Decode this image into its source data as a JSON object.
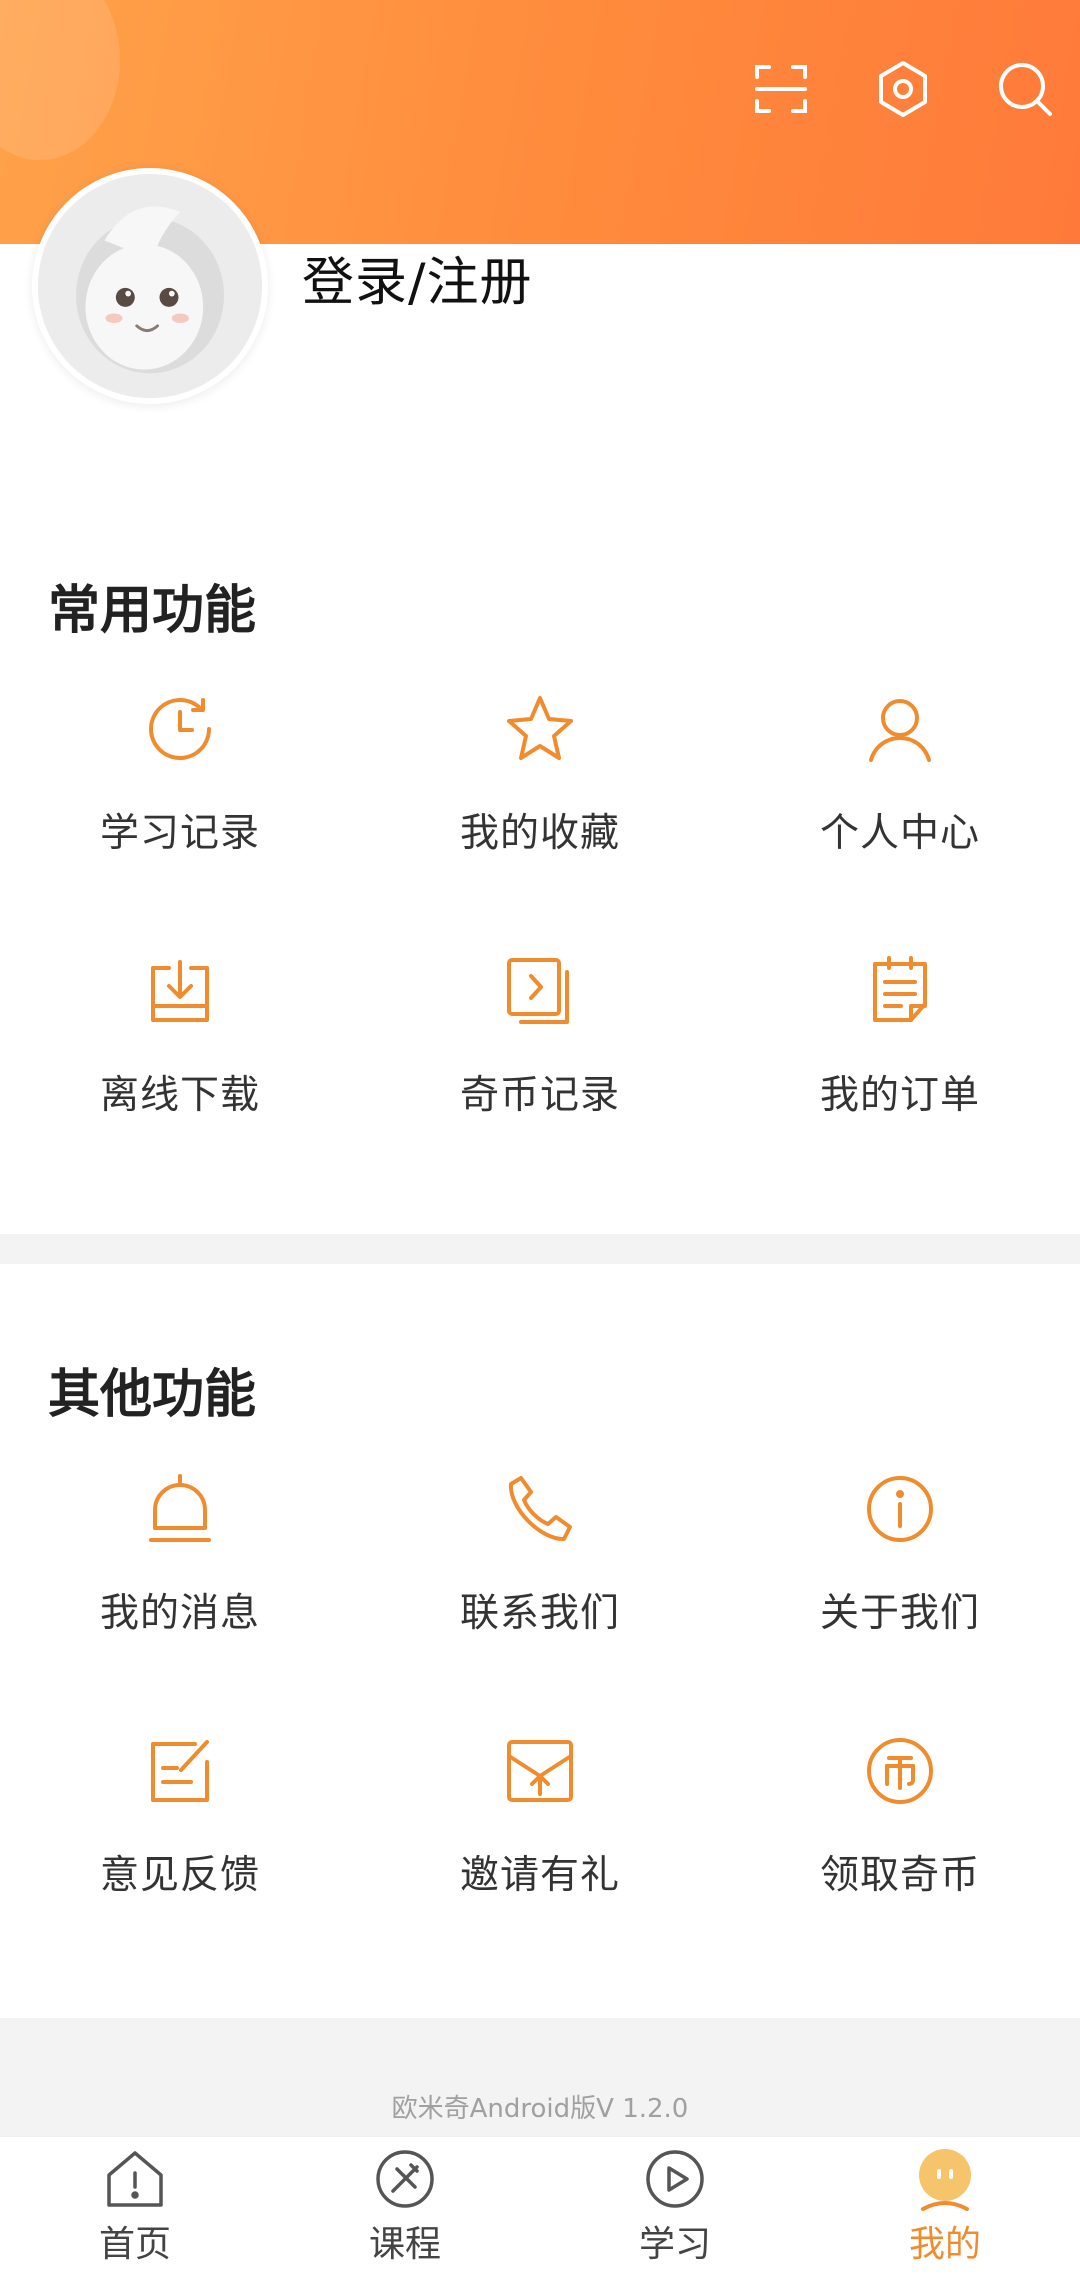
{
  "header": {
    "scan_icon": "scan-icon",
    "settings_icon": "settings-icon",
    "search_icon": "search-icon",
    "login_label": "登录/注册"
  },
  "common": {
    "title": "常用功能",
    "items": [
      {
        "label": "学习记录",
        "icon": "history-icon"
      },
      {
        "label": "我的收藏",
        "icon": "star-icon"
      },
      {
        "label": "个人中心",
        "icon": "user-icon"
      },
      {
        "label": "离线下载",
        "icon": "download-icon"
      },
      {
        "label": "奇币记录",
        "icon": "coin-record-icon"
      },
      {
        "label": "我的订单",
        "icon": "order-icon"
      }
    ]
  },
  "other": {
    "title": "其他功能",
    "items": [
      {
        "label": "我的消息",
        "icon": "bell-icon"
      },
      {
        "label": "联系我们",
        "icon": "phone-icon"
      },
      {
        "label": "关于我们",
        "icon": "info-icon"
      },
      {
        "label": "意见反馈",
        "icon": "feedback-icon"
      },
      {
        "label": "邀请有礼",
        "icon": "invite-icon"
      },
      {
        "label": "领取奇币",
        "icon": "coin-icon"
      }
    ]
  },
  "version": "欧米奇Android版V 1.2.0",
  "tabbar": {
    "items": [
      {
        "label": "首页",
        "icon": "home-icon"
      },
      {
        "label": "课程",
        "icon": "course-icon"
      },
      {
        "label": "学习",
        "icon": "play-icon"
      },
      {
        "label": "我的",
        "icon": "profile-icon"
      }
    ],
    "active_index": 3
  },
  "colors": {
    "accent": "#f08c2e",
    "header_start": "#ffa24a",
    "header_end": "#ff7a3a"
  }
}
